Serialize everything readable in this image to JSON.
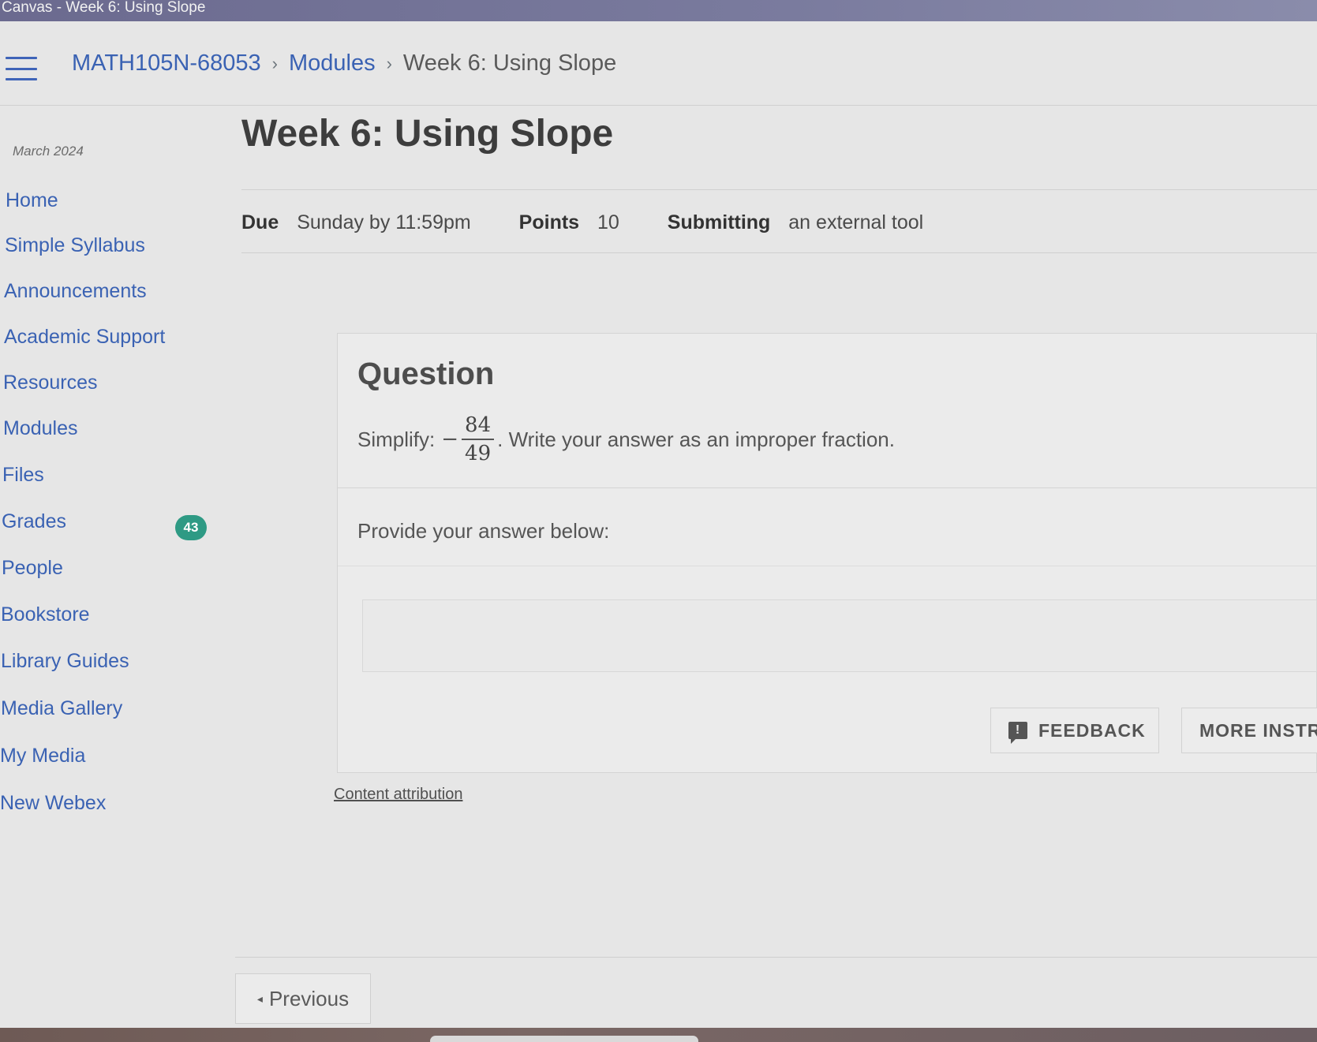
{
  "window": {
    "title": "Canvas - Week 6: Using Slope"
  },
  "breadcrumb": {
    "course": "MATH105N-68053",
    "modules": "Modules",
    "current": "Week 6: Using Slope",
    "separator": "›"
  },
  "sidebar": {
    "term": "March 2024",
    "items": [
      {
        "label": "Home"
      },
      {
        "label": "Simple Syllabus"
      },
      {
        "label": "Announcements"
      },
      {
        "label": "Academic Support"
      },
      {
        "label": "Resources"
      },
      {
        "label": "Modules"
      },
      {
        "label": "Files"
      },
      {
        "label": "Grades",
        "badge": "43"
      },
      {
        "label": "People"
      },
      {
        "label": "Bookstore"
      },
      {
        "label": "Library Guides"
      },
      {
        "label": "Media Gallery"
      },
      {
        "label": "My Media"
      },
      {
        "label": "New Webex"
      }
    ]
  },
  "assignment": {
    "title": "Week 6: Using Slope",
    "due_label": "Due",
    "due_value": "Sunday by 11:59pm",
    "points_label": "Points",
    "points_value": "10",
    "submitting_label": "Submitting",
    "submitting_value": "an external tool"
  },
  "question": {
    "heading": "Question",
    "prefix": "Simplify:",
    "sign": "−",
    "numerator": "84",
    "denominator": "49",
    "suffix": ". Write your answer as an improper fraction.",
    "prompt": "Provide your answer below:",
    "answer_value": ""
  },
  "buttons": {
    "feedback": "FEEDBACK",
    "feedback_icon_glyph": "!",
    "more_instructions": "MORE INSTR",
    "previous": "Previous",
    "previous_caret": "◂"
  },
  "footer": {
    "attribution": "Content attribution"
  },
  "colors": {
    "link": "#3a62b3",
    "badge": "#2e9a84"
  }
}
